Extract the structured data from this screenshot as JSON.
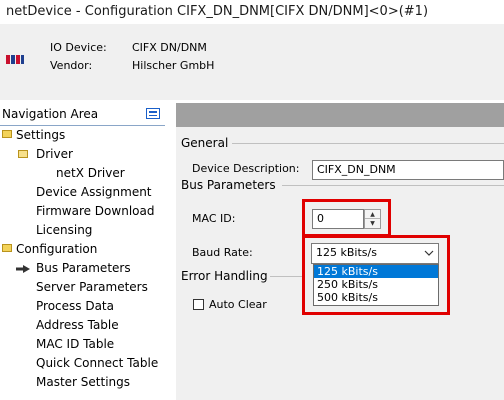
{
  "window": {
    "title": "netDevice - Configuration CIFX_DN_DNM[CIFX DN/DNM]<0>(#1)"
  },
  "header": {
    "io_device_label": "IO Device:",
    "io_device_value": "CIFX DN/DNM",
    "vendor_label": "Vendor:",
    "vendor_value": "Hilscher GmbH"
  },
  "nav": {
    "title": "Navigation Area",
    "items": [
      {
        "label": "Settings"
      },
      {
        "label": "Driver"
      },
      {
        "label": "netX Driver"
      },
      {
        "label": "Device Assignment"
      },
      {
        "label": "Firmware Download"
      },
      {
        "label": "Licensing"
      },
      {
        "label": "Configuration"
      },
      {
        "label": "Bus Parameters"
      },
      {
        "label": "Server Parameters"
      },
      {
        "label": "Process Data"
      },
      {
        "label": "Address Table"
      },
      {
        "label": "MAC ID Table"
      },
      {
        "label": "Quick Connect Table"
      },
      {
        "label": "Master Settings"
      }
    ]
  },
  "main": {
    "general_label": "General",
    "device_description_label": "Device Description:",
    "device_description_value": "CIFX_DN_DNM",
    "bus_parameters_label": "Bus Parameters",
    "mac_id_label": "MAC ID:",
    "mac_id_value": "0",
    "baud_rate_label": "Baud Rate:",
    "baud_rate_value": "125 kBits/s",
    "baud_rate_options": [
      "125 kBits/s",
      "250 kBits/s",
      "500 kBits/s"
    ],
    "error_handling_label": "Error Handling",
    "auto_clear_label": "Auto Clear"
  },
  "colors": {
    "highlight": "#e00000",
    "selection": "#0078d7",
    "panel": "#f0f0f0"
  }
}
